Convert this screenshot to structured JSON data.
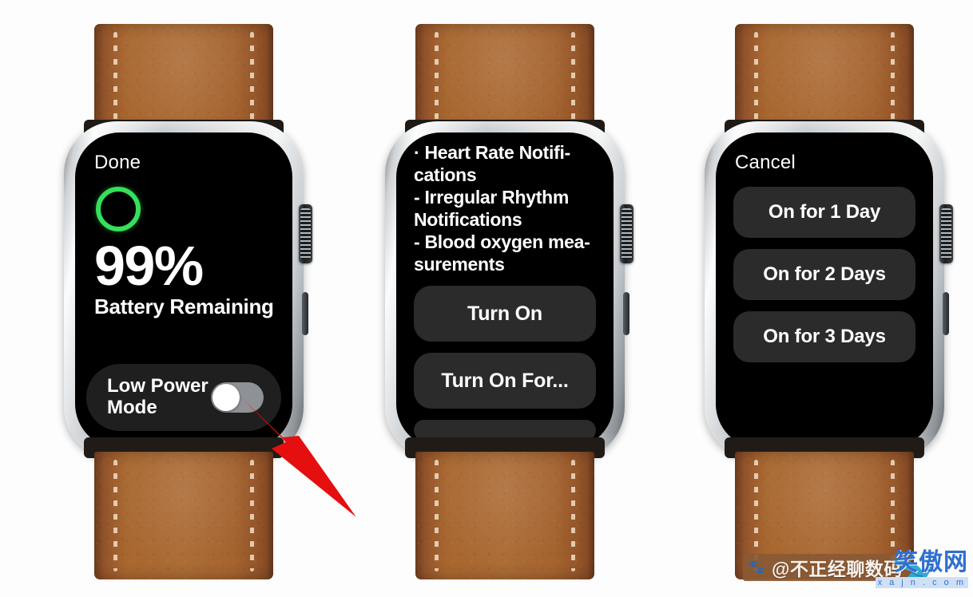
{
  "page": {
    "background_color": "#ffffff",
    "device": "apple-watch",
    "band_color": "#a4632f",
    "case_color": "#cdd1d4",
    "screen_color": "#000000",
    "accent_green": "#35e05a",
    "annotation_color": "#e60f0f"
  },
  "watches": [
    {
      "id": "battery-screen",
      "nav_label": "Done",
      "battery": {
        "percent": "99%",
        "caption": "Battery Remaining",
        "ring_color": "#35e05a"
      },
      "low_power_mode": {
        "label": "Low Power Mode",
        "toggle_state": "off",
        "track_color": "#8e9196",
        "knob_color": "#ffffff"
      }
    },
    {
      "id": "turn-on-screen",
      "description_lines": [
        "· Heart Rate Notifi-",
        "cations",
        "- Irregular Rhythm",
        "Notifications",
        "- Blood oxygen mea-",
        "surements"
      ],
      "buttons": [
        {
          "label": "Turn On"
        },
        {
          "label": "Turn On For..."
        }
      ]
    },
    {
      "id": "duration-screen",
      "nav_label": "Cancel",
      "choices": [
        {
          "label": "On for 1 Day"
        },
        {
          "label": "On for 2 Days"
        },
        {
          "label": "On for 3 Days"
        }
      ]
    }
  ],
  "annotation": {
    "type": "arrow",
    "color": "#e60f0f",
    "points_at": "low-power-mode-toggle"
  },
  "watermarks": {
    "baidu": {
      "icon": "baidu-paw-icon",
      "text": "@不正经聊数码",
      "background": "#8a5a35"
    },
    "xajn": {
      "text": "笑傲网",
      "url": "x a j n . c o m",
      "color": "#2f6fd0",
      "icon": "dolphin-icon"
    }
  }
}
